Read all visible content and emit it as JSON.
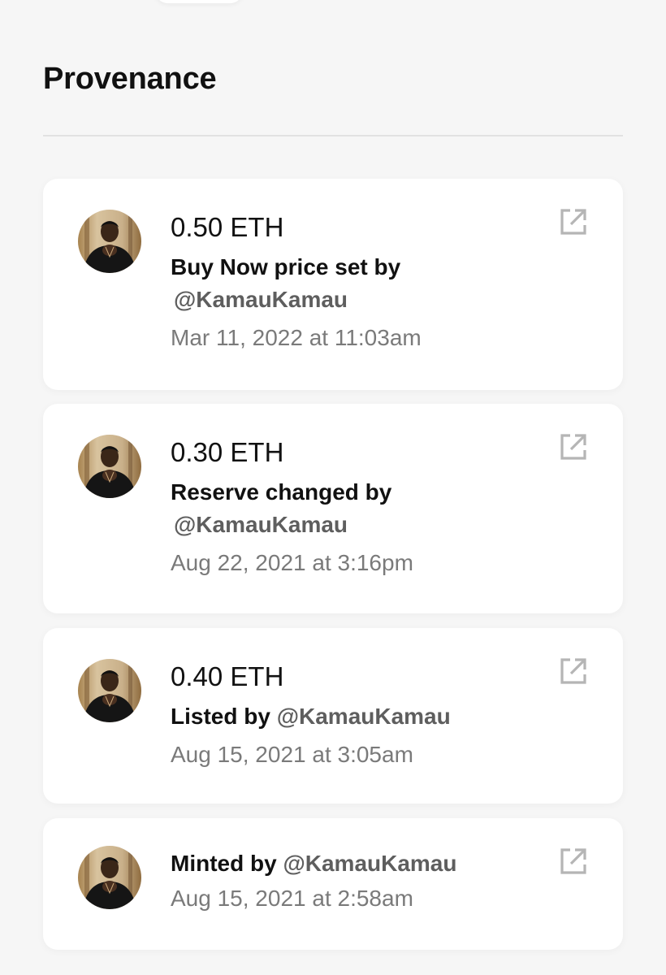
{
  "section": {
    "title": "Provenance"
  },
  "events": [
    {
      "amount": "0.50 ETH",
      "action": "Buy Now price set by",
      "handle": "@KamauKamau",
      "date": "Mar 11, 2022 at 11:03am",
      "link_icon": "external-link-icon"
    },
    {
      "amount": "0.30 ETH",
      "action": "Reserve changed by",
      "handle": "@KamauKamau",
      "date": "Aug 22, 2021 at 3:16pm",
      "link_icon": "external-link-icon"
    },
    {
      "amount": "0.40 ETH",
      "action": "Listed by",
      "handle": "@KamauKamau",
      "date": "Aug 15, 2021 at 3:05am",
      "link_icon": "external-link-icon"
    },
    {
      "action": "Minted by",
      "handle": "@KamauKamau",
      "date": "Aug 15, 2021 at 2:58am",
      "link_icon": "external-link-icon"
    }
  ],
  "colors": {
    "background": "#f6f6f6",
    "card": "#ffffff",
    "primary_text": "#111111",
    "handle_text": "#5e5e5e",
    "date_text": "#7a7a7a",
    "icon": "#b5b5b5"
  }
}
